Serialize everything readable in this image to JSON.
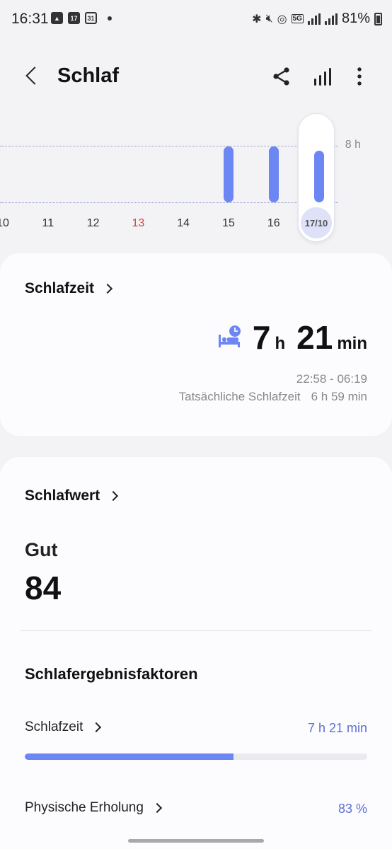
{
  "status_bar": {
    "time": "16:31",
    "calendar_day_1": "17",
    "calendar_day_2": "31",
    "network": "5G",
    "battery": "81%"
  },
  "header": {
    "title": "Schlaf"
  },
  "chart": {
    "grid_label": "8 h",
    "days": [
      {
        "label": "10",
        "hours": null,
        "sunday": false
      },
      {
        "label": "11",
        "hours": null,
        "sunday": false
      },
      {
        "label": "12",
        "hours": null,
        "sunday": false
      },
      {
        "label": "13",
        "hours": null,
        "sunday": true
      },
      {
        "label": "14",
        "hours": null,
        "sunday": false
      },
      {
        "label": "15",
        "hours": 7.9,
        "sunday": false
      },
      {
        "label": "16",
        "hours": 7.9,
        "sunday": false
      },
      {
        "label": "17/10",
        "hours": 7.35,
        "sunday": false,
        "selected": true
      }
    ],
    "colors": {
      "bar": "#6c86f4",
      "sunday": "#d04535",
      "selected_chip": "#dfe1f8"
    }
  },
  "sleep_time_card": {
    "title": "Schlafzeit",
    "hours": "7",
    "hours_unit": "h",
    "minutes": "21",
    "minutes_unit": "min",
    "time_range": "22:58 - 06:19",
    "actual_label": "Tatsächliche Schlafzeit",
    "actual_value": "6 h 59 min"
  },
  "score_card": {
    "title": "Schlafwert",
    "rating": "Gut",
    "score": "84",
    "factors_title": "Schlafergebnisfaktoren",
    "factors": [
      {
        "label": "Schlafzeit",
        "value": "7 h 21 min",
        "progress": 0.61
      },
      {
        "label": "Physische Erholung",
        "value": "83 %",
        "progress": 0.83
      }
    ]
  }
}
